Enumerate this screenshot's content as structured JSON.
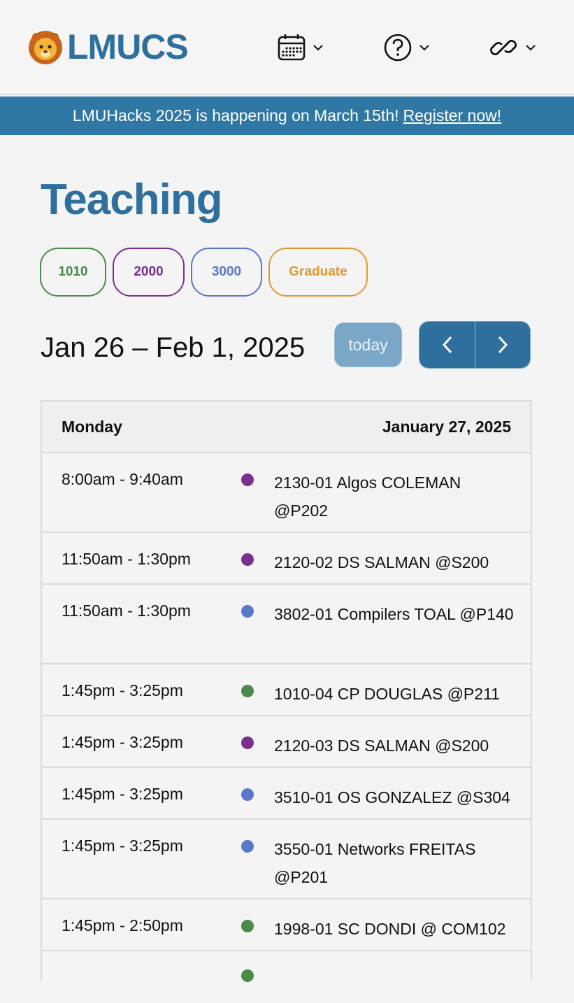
{
  "header": {
    "brand": "LMUCS",
    "nav": [
      {
        "icon": "calendar-icon"
      },
      {
        "icon": "help-circle-icon"
      },
      {
        "icon": "link-icon"
      }
    ]
  },
  "banner": {
    "text": "LMUHacks 2025 is happening on March 15th!",
    "link_text": "Register now!"
  },
  "page": {
    "title": "Teaching",
    "filters": [
      {
        "label": "1010",
        "color": "#4a8a4a"
      },
      {
        "label": "2000",
        "color": "#7b2f8f"
      },
      {
        "label": "3000",
        "color": "#5a78c8"
      },
      {
        "label": "Graduate",
        "color": "#e0972f"
      }
    ],
    "date_range": "Jan 26 – Feb 1, 2025",
    "today_label": "today"
  },
  "schedule": {
    "day": "Monday",
    "date": "January 27, 2025",
    "events": [
      {
        "time": "8:00am - 9:40am",
        "title": "2130-01 Algos COLEMAN @P202",
        "color": "#7b2f8f"
      },
      {
        "time": "11:50am - 1:30pm",
        "title": "2120-02 DS SALMAN @S200",
        "color": "#7b2f8f"
      },
      {
        "time": "11:50am - 1:30pm",
        "title": "3802-01 Compilers TOAL @P140",
        "color": "#5a78c8"
      },
      {
        "time": "1:45pm - 3:25pm",
        "title": "1010-04 CP DOUGLAS @P211",
        "color": "#4a8a4a"
      },
      {
        "time": "1:45pm - 3:25pm",
        "title": "2120-03 DS SALMAN @S200",
        "color": "#7b2f8f"
      },
      {
        "time": "1:45pm - 3:25pm",
        "title": "3510-01 OS GONZALEZ @S304",
        "color": "#5a78c8"
      },
      {
        "time": "1:45pm - 3:25pm",
        "title": "3550-01 Networks FREITAS @P201",
        "color": "#5a78c8"
      },
      {
        "time": "1:45pm - 2:50pm",
        "title": "1998-01 SC DONDI @ COM102",
        "color": "#4a8a4a"
      }
    ]
  }
}
